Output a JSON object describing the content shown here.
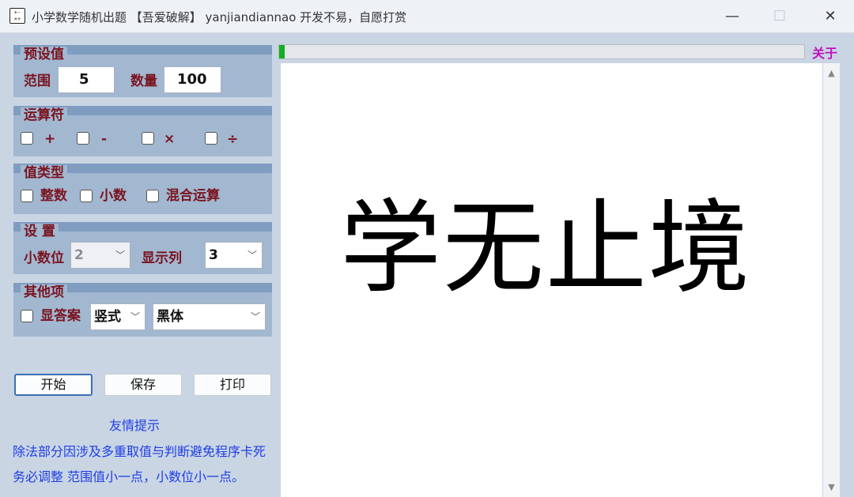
{
  "window": {
    "title": "小学数学随机出题 【吾爱破解】 yanjiandiannao 开发不易，自愿打赏",
    "icon": "calculator-icon"
  },
  "preset": {
    "title": "预设值",
    "range_label": "范围",
    "range_value": "5",
    "count_label": "数量",
    "count_value": "100"
  },
  "operators": {
    "title": "运算符",
    "items": [
      {
        "label": "+",
        "checked": false
      },
      {
        "label": "-",
        "checked": false
      },
      {
        "label": "×",
        "checked": false
      },
      {
        "label": "÷",
        "checked": false
      }
    ]
  },
  "value_type": {
    "title": "值类型",
    "items": [
      {
        "label": "整数",
        "checked": false
      },
      {
        "label": "小数",
        "checked": false
      },
      {
        "label": "混合运算",
        "checked": false
      }
    ]
  },
  "settings": {
    "title": "设 置",
    "decimal_label": "小数位",
    "decimal_value": "2",
    "columns_label": "显示列",
    "columns_value": "3"
  },
  "other": {
    "title": "其他项",
    "show_answer_label": "显答案",
    "layout_value": "竖式",
    "font_value": "黑体"
  },
  "buttons": {
    "start": "开始",
    "save": "保存",
    "print": "打印"
  },
  "tips": {
    "title": "友情提示",
    "line1": "除法部分因涉及多重取值与判断避免程序卡死",
    "line2": "务必调整  范围值小一点，小数位小一点。"
  },
  "progress": {
    "value": 0.01
  },
  "about": "关于",
  "display_text": "学无止境",
  "colors": {
    "label": "#7a1420",
    "tip": "#1e3ee6",
    "about": "#c010c0",
    "progress": "#10b020",
    "panel": "#a2b7d0"
  }
}
